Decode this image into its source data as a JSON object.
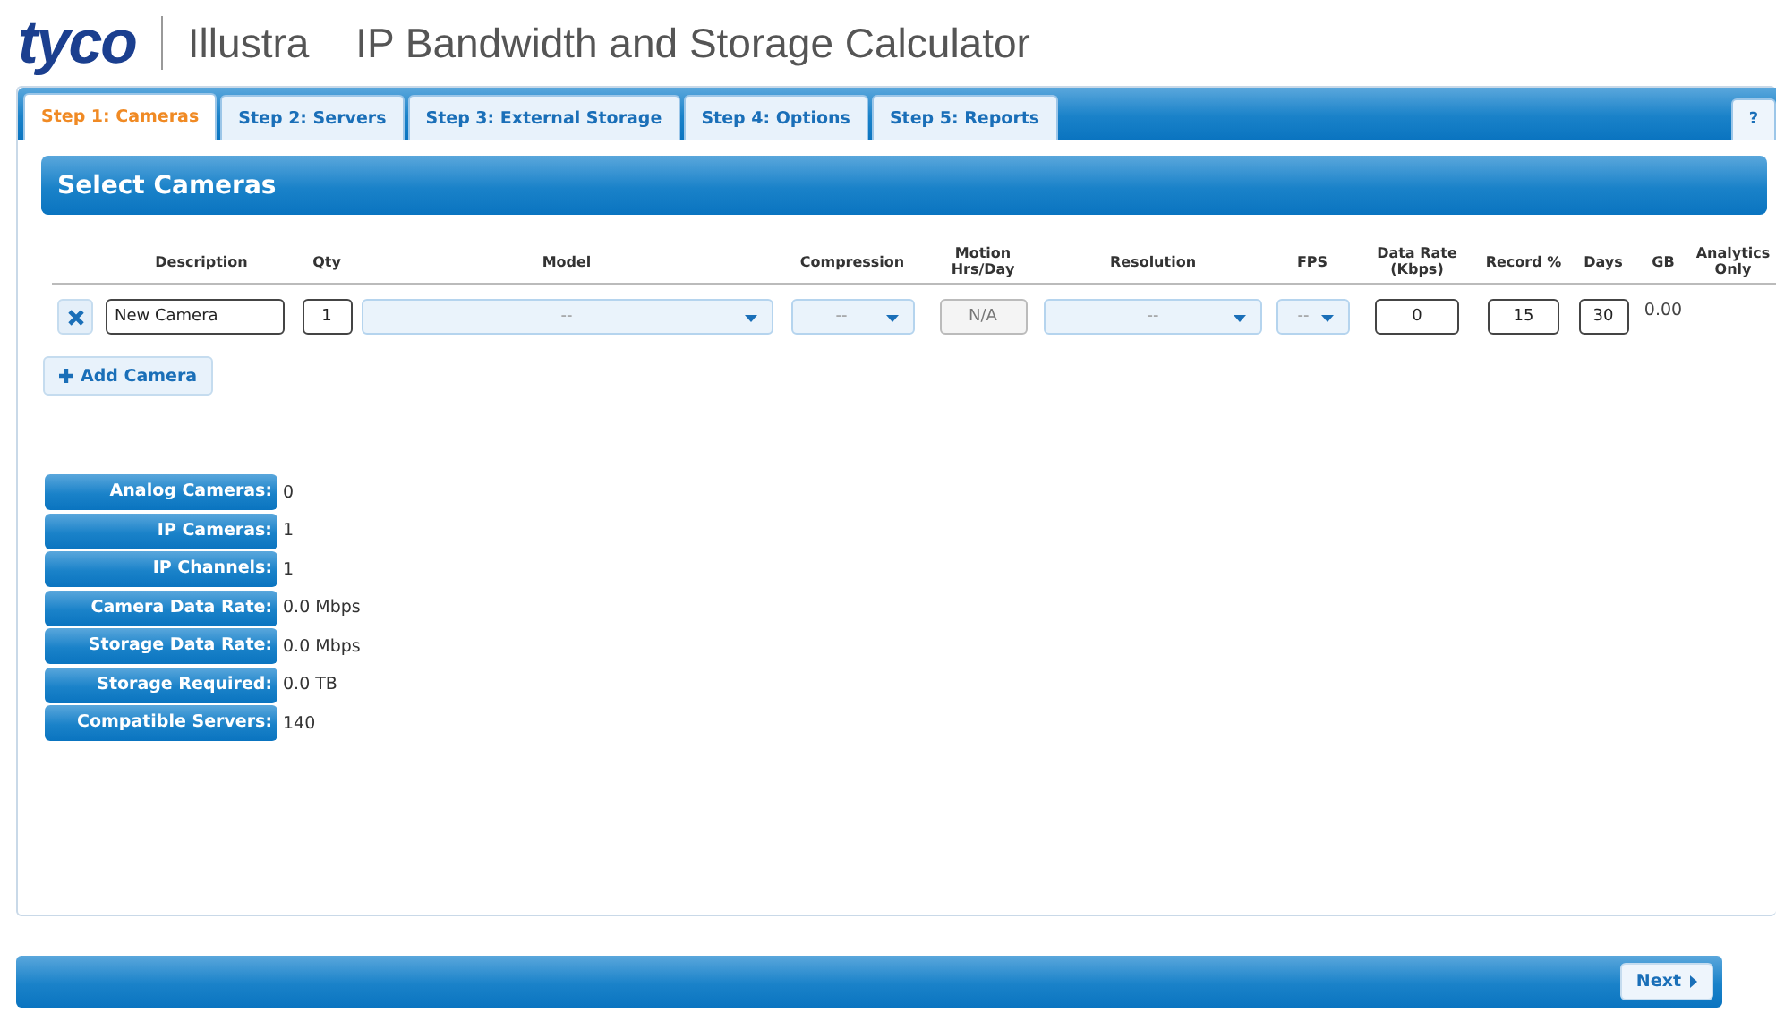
{
  "header": {
    "logo": "tyco",
    "product": "Illustra",
    "title": "IP Bandwidth and Storage Calculator"
  },
  "tabs": [
    {
      "label": "Step 1: Cameras",
      "selected": true
    },
    {
      "label": "Step 2: Servers",
      "selected": false
    },
    {
      "label": "Step 3: External Storage",
      "selected": false
    },
    {
      "label": "Step 4: Options",
      "selected": false
    },
    {
      "label": "Step 5: Reports",
      "selected": false
    }
  ],
  "help_button": "?",
  "section_title": "Select Cameras",
  "columns": [
    "Description",
    "Qty",
    "Model",
    "Compression",
    "Motion Hrs/Day",
    "Resolution",
    "FPS",
    "Data Rate (Kbps)",
    "Record %",
    "Days",
    "GB",
    "Analytics Only"
  ],
  "cameras": [
    {
      "description": "New Camera",
      "qty": "1",
      "model": "--",
      "compression": "--",
      "motion": "N/A",
      "resolution": "--",
      "fps": "--",
      "data_rate": "0",
      "record": "15",
      "days": "30",
      "gb": "0.00"
    }
  ],
  "add_button": "Add Camera",
  "summary": [
    {
      "label": "Analog Cameras:",
      "value": "0"
    },
    {
      "label": "IP Cameras:",
      "value": "1"
    },
    {
      "label": "IP Channels:",
      "value": "1"
    },
    {
      "label": "Camera Data Rate:",
      "value": "0.0 Mbps"
    },
    {
      "label": "Storage Data Rate:",
      "value": "0.0 Mbps"
    },
    {
      "label": "Storage Required:",
      "value": "0.0 TB"
    },
    {
      "label": "Compatible Servers:",
      "value": "140"
    }
  ],
  "next_button": "Next"
}
